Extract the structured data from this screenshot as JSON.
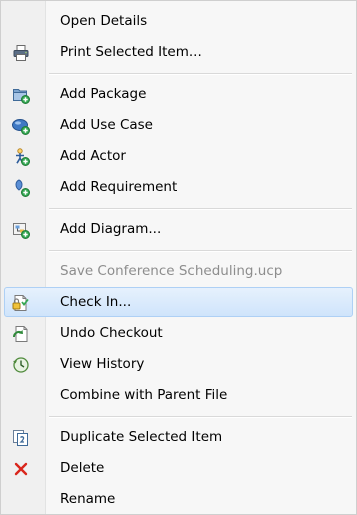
{
  "menu": {
    "items": [
      {
        "label": "Open Details",
        "icon": "none",
        "disabled": false
      },
      {
        "label": "Print Selected Item...",
        "icon": "printer-icon",
        "disabled": false
      },
      {
        "label": "Add Package",
        "icon": "add-package-icon",
        "disabled": false
      },
      {
        "label": "Add Use Case",
        "icon": "add-use-case-icon",
        "disabled": false
      },
      {
        "label": "Add Actor",
        "icon": "add-actor-icon",
        "disabled": false
      },
      {
        "label": "Add Requirement",
        "icon": "add-requirement-icon",
        "disabled": false
      },
      {
        "label": "Add Diagram...",
        "icon": "add-diagram-icon",
        "disabled": false
      },
      {
        "label": "Save Conference Scheduling.ucp",
        "icon": "none",
        "disabled": true
      },
      {
        "label": "Check In...",
        "icon": "check-in-icon",
        "disabled": false,
        "highlighted": true
      },
      {
        "label": "Undo Checkout",
        "icon": "undo-checkout-icon",
        "disabled": false
      },
      {
        "label": "View History",
        "icon": "view-history-icon",
        "disabled": false
      },
      {
        "label": "Combine with Parent File",
        "icon": "none",
        "disabled": false
      },
      {
        "label": "Duplicate Selected Item",
        "icon": "duplicate-icon",
        "disabled": false
      },
      {
        "label": "Delete",
        "icon": "delete-icon",
        "disabled": false
      },
      {
        "label": "Rename",
        "icon": "none",
        "disabled": false
      }
    ]
  },
  "colors": {
    "highlight_fill": "#cfe4fb",
    "highlight_border": "#aed0f5",
    "disabled_text": "#8d8d8d",
    "delete_icon": "#d9261c",
    "add_badge": "#34a853"
  }
}
